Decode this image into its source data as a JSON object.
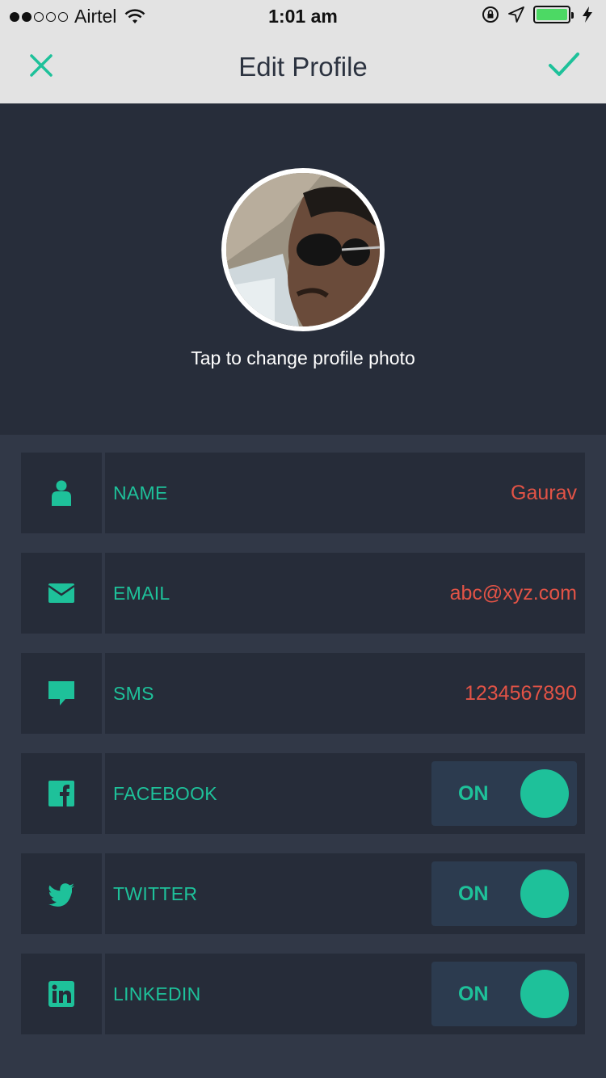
{
  "status_bar": {
    "carrier": "Airtel",
    "time": "1:01 am",
    "signal_bars": 2,
    "battery_color": "#4cd964"
  },
  "nav": {
    "title": "Edit Profile",
    "close_icon": "close-icon",
    "confirm_icon": "checkmark-icon"
  },
  "profile": {
    "change_photo_label": "Tap to change profile photo"
  },
  "fields": [
    {
      "icon": "person-icon",
      "label": "NAME",
      "value": "Gaurav"
    },
    {
      "icon": "envelope-icon",
      "label": "EMAIL",
      "value": "abc@xyz.com"
    },
    {
      "icon": "chat-bubble-icon",
      "label": "SMS",
      "value": "1234567890"
    }
  ],
  "social": [
    {
      "icon": "facebook-icon",
      "label": "FACEBOOK",
      "toggle": "ON"
    },
    {
      "icon": "twitter-icon",
      "label": "TWITTER",
      "toggle": "ON"
    },
    {
      "icon": "linkedin-icon",
      "label": "LINKEDIN",
      "toggle": "ON"
    }
  ],
  "colors": {
    "accent": "#1ec19a",
    "value_text": "#e25346",
    "background": "#313847",
    "panel": "#262c39"
  }
}
